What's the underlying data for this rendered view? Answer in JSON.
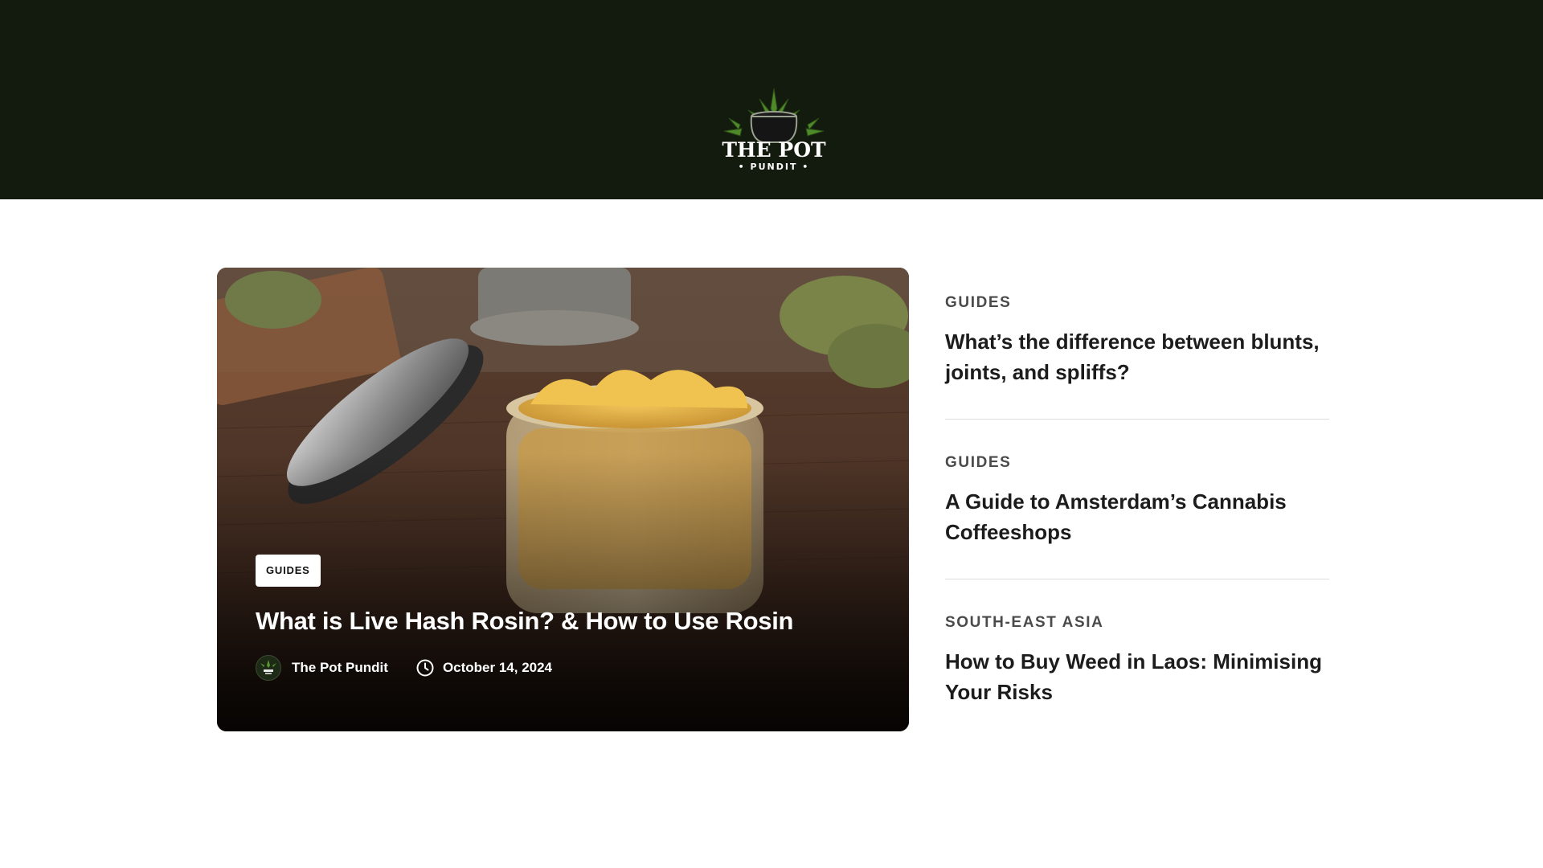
{
  "header": {
    "logo_text_main": "THE POT",
    "logo_text_sub": "PUNDIT",
    "bg_color": "#131b0e"
  },
  "feature": {
    "category": "GUIDES",
    "title": "What is Live Hash Rosin? & How to Use Rosin",
    "author": "The Pot Pundit",
    "date": "October 14, 2024",
    "author_icon": "avatar-logo",
    "date_icon": "clock-icon"
  },
  "sidebar": {
    "items": [
      {
        "category": "GUIDES",
        "title": "What’s the difference between blunts, joints, and spliffs?"
      },
      {
        "category": "GUIDES",
        "title": "A Guide to Amsterdam’s Cannabis Coffeeshops"
      },
      {
        "category": "SOUTH-EAST ASIA",
        "title": "How to Buy Weed in Laos: Minimising Your Risks"
      }
    ]
  }
}
